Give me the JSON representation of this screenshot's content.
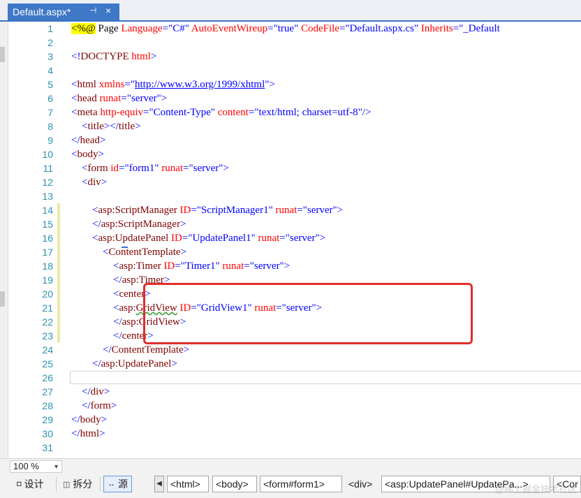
{
  "tab": {
    "title": "Default.aspx*",
    "pin_icon": "pin-icon",
    "close_icon": "close-icon"
  },
  "editor": {
    "lines": [
      {
        "n": "1",
        "tokens": [
          [
            "dir",
            "<%@"
          ],
          [
            "plain",
            " Page "
          ],
          [
            "attr",
            "Language"
          ],
          [
            "punc",
            "=\""
          ],
          [
            "val",
            "C#"
          ],
          [
            "punc",
            "\""
          ],
          [
            "plain",
            " "
          ],
          [
            "attr",
            "AutoEventWireup"
          ],
          [
            "punc",
            "=\""
          ],
          [
            "val",
            "true"
          ],
          [
            "punc",
            "\""
          ],
          [
            "plain",
            " "
          ],
          [
            "attr",
            "CodeFile"
          ],
          [
            "punc",
            "=\""
          ],
          [
            "val",
            "Default.aspx.cs"
          ],
          [
            "punc",
            "\""
          ],
          [
            "plain",
            " "
          ],
          [
            "attr",
            "Inherits"
          ],
          [
            "punc",
            "=\""
          ],
          [
            "val",
            "_Default"
          ]
        ]
      },
      {
        "n": "2",
        "tokens": []
      },
      {
        "n": "3",
        "tokens": [
          [
            "punc",
            "<!"
          ],
          [
            "tag",
            "DOCTYPE"
          ],
          [
            "plain",
            " "
          ],
          [
            "attr",
            "html"
          ],
          [
            "punc",
            ">"
          ]
        ]
      },
      {
        "n": "4",
        "tokens": []
      },
      {
        "n": "5",
        "tokens": [
          [
            "punc",
            "<"
          ],
          [
            "tag",
            "html"
          ],
          [
            "plain",
            " "
          ],
          [
            "attr",
            "xmlns"
          ],
          [
            "punc",
            "=\""
          ],
          [
            "link",
            "http://www.w3.org/1999/xhtml"
          ],
          [
            "punc",
            "\">"
          ]
        ]
      },
      {
        "n": "6",
        "tokens": [
          [
            "punc",
            "<"
          ],
          [
            "tag",
            "head"
          ],
          [
            "plain",
            " "
          ],
          [
            "attr",
            "runat"
          ],
          [
            "punc",
            "=\""
          ],
          [
            "val",
            "server"
          ],
          [
            "punc",
            "\">"
          ]
        ]
      },
      {
        "n": "7",
        "tokens": [
          [
            "punc",
            "<"
          ],
          [
            "tag",
            "meta"
          ],
          [
            "plain",
            " "
          ],
          [
            "attr",
            "http-equiv"
          ],
          [
            "punc",
            "=\""
          ],
          [
            "val",
            "Content-Type"
          ],
          [
            "punc",
            "\""
          ],
          [
            "plain",
            " "
          ],
          [
            "attr",
            "content"
          ],
          [
            "punc",
            "=\""
          ],
          [
            "val",
            "text/html; charset=utf-8"
          ],
          [
            "punc",
            "\"/>"
          ]
        ]
      },
      {
        "n": "8",
        "tokens": [
          [
            "plain",
            "    "
          ],
          [
            "punc",
            "<"
          ],
          [
            "tag",
            "title"
          ],
          [
            "punc",
            "></"
          ],
          [
            "tag",
            "title"
          ],
          [
            "punc",
            ">"
          ]
        ]
      },
      {
        "n": "9",
        "tokens": [
          [
            "punc",
            "</"
          ],
          [
            "tag",
            "head"
          ],
          [
            "punc",
            ">"
          ]
        ]
      },
      {
        "n": "10",
        "tokens": [
          [
            "punc",
            "<"
          ],
          [
            "tag",
            "body"
          ],
          [
            "punc",
            ">"
          ]
        ]
      },
      {
        "n": "11",
        "tokens": [
          [
            "plain",
            "    "
          ],
          [
            "punc",
            "<"
          ],
          [
            "tag",
            "form"
          ],
          [
            "plain",
            " "
          ],
          [
            "attr",
            "id"
          ],
          [
            "punc",
            "=\""
          ],
          [
            "val",
            "form1"
          ],
          [
            "punc",
            "\""
          ],
          [
            "plain",
            " "
          ],
          [
            "attr",
            "runat"
          ],
          [
            "punc",
            "=\""
          ],
          [
            "val",
            "server"
          ],
          [
            "punc",
            "\">"
          ]
        ]
      },
      {
        "n": "12",
        "tokens": [
          [
            "plain",
            "    "
          ],
          [
            "punc",
            "<"
          ],
          [
            "tag",
            "div"
          ],
          [
            "punc",
            ">"
          ]
        ]
      },
      {
        "n": "13",
        "tokens": []
      },
      {
        "n": "14",
        "tokens": [
          [
            "plain",
            "        "
          ],
          [
            "punc",
            "<"
          ],
          [
            "tag",
            "asp:ScriptManager"
          ],
          [
            "plain",
            " "
          ],
          [
            "attr",
            "ID"
          ],
          [
            "punc",
            "=\""
          ],
          [
            "val",
            "ScriptManager1"
          ],
          [
            "punc",
            "\""
          ],
          [
            "plain",
            " "
          ],
          [
            "attr",
            "runat"
          ],
          [
            "punc",
            "=\""
          ],
          [
            "val",
            "server"
          ],
          [
            "punc",
            "\">"
          ]
        ],
        "changed": true
      },
      {
        "n": "15",
        "tokens": [
          [
            "plain",
            "        "
          ],
          [
            "punc",
            "</"
          ],
          [
            "tag",
            "asp:ScriptManager"
          ],
          [
            "punc",
            ">"
          ]
        ],
        "changed": true
      },
      {
        "n": "16",
        "tokens": [
          [
            "plain",
            "        "
          ],
          [
            "punc",
            "<"
          ],
          [
            "tag",
            "asp:UpdatePanel"
          ],
          [
            "plain",
            " "
          ],
          [
            "attr",
            "ID"
          ],
          [
            "punc",
            "=\""
          ],
          [
            "val",
            "UpdatePanel1"
          ],
          [
            "punc",
            "\""
          ],
          [
            "plain",
            " "
          ],
          [
            "attr",
            "runat"
          ],
          [
            "punc",
            "=\""
          ],
          [
            "val",
            "server"
          ],
          [
            "punc",
            "\">"
          ]
        ],
        "changed": true
      },
      {
        "n": "17",
        "tokens": [
          [
            "plain",
            "            "
          ],
          [
            "punc",
            "<"
          ],
          [
            "tag",
            "ContentTemplate"
          ],
          [
            "punc",
            ">"
          ]
        ],
        "changed": true
      },
      {
        "n": "18",
        "tokens": [
          [
            "plain",
            "                "
          ],
          [
            "punc",
            "<"
          ],
          [
            "tag",
            "asp:Timer"
          ],
          [
            "plain",
            " "
          ],
          [
            "attr",
            "ID"
          ],
          [
            "punc",
            "=\""
          ],
          [
            "val",
            "Timer1"
          ],
          [
            "punc",
            "\""
          ],
          [
            "plain",
            " "
          ],
          [
            "attr",
            "runat"
          ],
          [
            "punc",
            "=\""
          ],
          [
            "val",
            "server"
          ],
          [
            "punc",
            "\">"
          ]
        ],
        "changed": true
      },
      {
        "n": "19",
        "tokens": [
          [
            "plain",
            "                "
          ],
          [
            "punc",
            "</"
          ],
          [
            "tag",
            "asp:Timer"
          ],
          [
            "punc",
            ">"
          ]
        ],
        "changed": true
      },
      {
        "n": "20",
        "tokens": [
          [
            "plain",
            "                "
          ],
          [
            "punc",
            "<"
          ],
          [
            "tag",
            "center"
          ],
          [
            "punc",
            ">"
          ]
        ],
        "changed": true
      },
      {
        "n": "21",
        "tokens": [
          [
            "plain",
            "                "
          ],
          [
            "punc",
            "<"
          ],
          [
            "tag",
            "asp:"
          ],
          [
            "squig",
            "GridView"
          ],
          [
            "plain",
            " "
          ],
          [
            "attr",
            "ID"
          ],
          [
            "punc",
            "=\""
          ],
          [
            "val",
            "GridView1"
          ],
          [
            "punc",
            "\""
          ],
          [
            "plain",
            " "
          ],
          [
            "attr",
            "runat"
          ],
          [
            "punc",
            "=\""
          ],
          [
            "val",
            "server"
          ],
          [
            "punc",
            "\">"
          ]
        ],
        "changed": true
      },
      {
        "n": "22",
        "tokens": [
          [
            "plain",
            "                "
          ],
          [
            "punc",
            "</"
          ],
          [
            "tag",
            "asp:GridView"
          ],
          [
            "punc",
            ">"
          ]
        ],
        "changed": true
      },
      {
        "n": "23",
        "tokens": [
          [
            "plain",
            "                "
          ],
          [
            "punc",
            "</"
          ],
          [
            "tag",
            "center"
          ],
          [
            "punc",
            ">"
          ]
        ],
        "changed": true
      },
      {
        "n": "24",
        "tokens": [
          [
            "plain",
            "            "
          ],
          [
            "punc",
            "</"
          ],
          [
            "tag",
            "ContentTemplate"
          ],
          [
            "punc",
            ">"
          ]
        ]
      },
      {
        "n": "25",
        "tokens": [
          [
            "plain",
            "        "
          ],
          [
            "punc",
            "</"
          ],
          [
            "tag",
            "asp:UpdatePanel"
          ],
          [
            "punc",
            ">"
          ]
        ]
      },
      {
        "n": "26",
        "tokens": []
      },
      {
        "n": "27",
        "tokens": [
          [
            "plain",
            "    "
          ],
          [
            "punc",
            "</"
          ],
          [
            "tag",
            "div"
          ],
          [
            "punc",
            ">"
          ]
        ]
      },
      {
        "n": "28",
        "tokens": [
          [
            "plain",
            "    "
          ],
          [
            "punc",
            "</"
          ],
          [
            "tag",
            "form"
          ],
          [
            "punc",
            ">"
          ]
        ]
      },
      {
        "n": "29",
        "tokens": [
          [
            "punc",
            "</"
          ],
          [
            "tag",
            "body"
          ],
          [
            "punc",
            ">"
          ]
        ]
      },
      {
        "n": "30",
        "tokens": [
          [
            "punc",
            "</"
          ],
          [
            "tag",
            "html"
          ],
          [
            "punc",
            ">"
          ]
        ]
      },
      {
        "n": "31",
        "tokens": []
      }
    ]
  },
  "statusbar": {
    "zoom": "100 %",
    "views": [
      {
        "label": "设计",
        "icon": "design-icon",
        "active": false
      },
      {
        "label": "拆分",
        "icon": "split-icon",
        "active": false
      },
      {
        "label": "源",
        "icon": "source-icon",
        "active": true
      }
    ],
    "breadcrumbs": [
      "<html>",
      "<body>",
      "<form#form1>",
      "<div>",
      "<asp:UpdatePanel#UpdatePa...>",
      "<Cor"
    ],
    "watermark": "@稀土掘金技术社区"
  },
  "colors": {
    "tab_active": "#3e78c6",
    "line_number": "#2b91af",
    "tag": "#800000",
    "attribute": "#ff0000",
    "value": "#0000ff",
    "highlight_box": "#e12d2d",
    "change_bar": "#eee8a4"
  }
}
